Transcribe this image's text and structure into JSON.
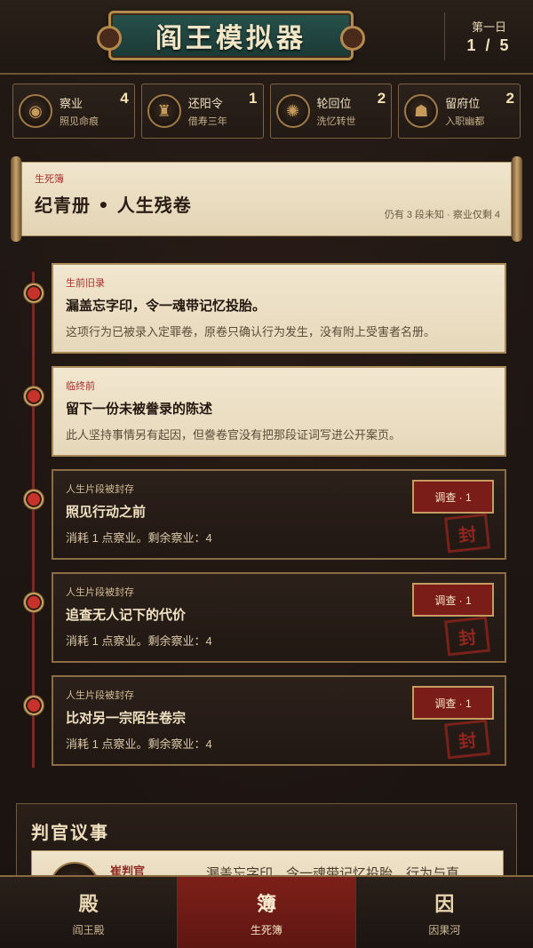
{
  "header": {
    "title": "阎王模拟器",
    "day_label": "第一日",
    "day_count": "1 / 5"
  },
  "resources": [
    {
      "name": "察业",
      "sub": "照见命痕",
      "count": "4",
      "icon": "karma-eye-icon"
    },
    {
      "name": "还阳令",
      "sub": "借寿三年",
      "count": "1",
      "icon": "resurrection-token-icon"
    },
    {
      "name": "轮回位",
      "sub": "洗忆转世",
      "count": "2",
      "icon": "reincarnation-wheel-icon"
    },
    {
      "name": "留府位",
      "sub": "入职幽都",
      "count": "2",
      "icon": "underworld-post-icon"
    }
  ],
  "scroll": {
    "tag": "生死簿",
    "title": "纪青册  •  人生残卷",
    "note": "仍有 3 段未知 · 察业仅剩 4"
  },
  "entries": [
    {
      "tag": "生前旧录",
      "title": "漏盖忘字印，令一魂带记忆投胎。",
      "desc": "这项行为已被录入定罪卷，原卷只确认行为发生，没有附上受害者名册。"
    },
    {
      "tag": "临终前",
      "title": "留下一份未被誊录的陈述",
      "desc": "此人坚持事情另有起因，但誊卷官没有把那段证词写进公开案页。"
    },
    {
      "tag": "人生片段被封存",
      "title": "照见行动之前",
      "desc": "消耗 1 点察业。剩余察业：4",
      "button": "调查 · 1",
      "stamp": "封"
    },
    {
      "tag": "人生片段被封存",
      "title": "追查无人记下的代价",
      "desc": "消耗 1 点察业。剩余察业：4",
      "button": "调查 · 1",
      "stamp": "封"
    },
    {
      "tag": "人生片段被封存",
      "title": "比对另一宗陌生卷宗",
      "desc": "消耗 1 点察业。剩余察业：4",
      "button": "调查 · 1",
      "stamp": "封"
    }
  ],
  "judge": {
    "title": "判官议事",
    "name": "崔判官",
    "text": "漏盖忘字印，令一魂带记忆投胎，行为与直"
  },
  "nav": [
    {
      "glyph": "殿",
      "label": "阎王殿",
      "active": false
    },
    {
      "glyph": "簿",
      "label": "生死簿",
      "active": true
    },
    {
      "glyph": "因",
      "label": "因果河",
      "active": false
    }
  ]
}
